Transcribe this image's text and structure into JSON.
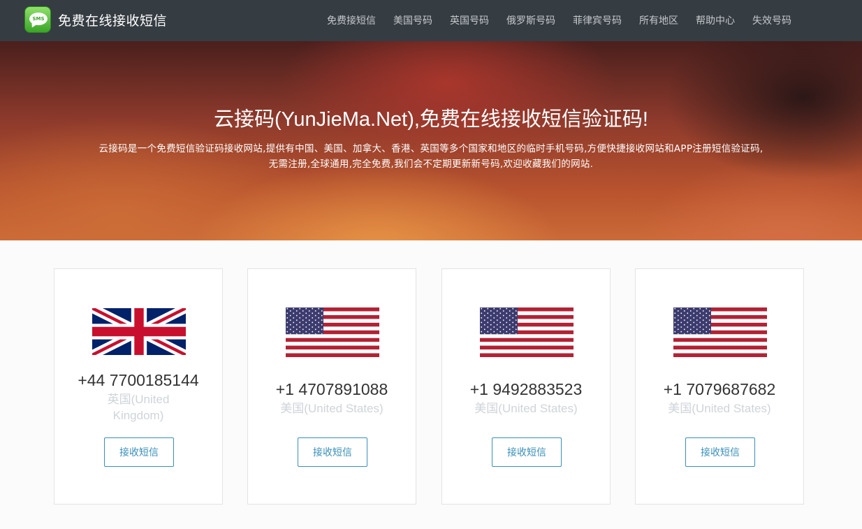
{
  "navbar": {
    "brand_icon_text": "SMS",
    "brand_title": "免费在线接收短信",
    "items": [
      {
        "label": "免费接短信"
      },
      {
        "label": "美国号码"
      },
      {
        "label": "英国号码"
      },
      {
        "label": "俄罗斯号码"
      },
      {
        "label": "菲律宾号码"
      },
      {
        "label": "所有地区"
      },
      {
        "label": "帮助中心"
      },
      {
        "label": "失效号码"
      }
    ]
  },
  "hero": {
    "title": "云接码(YunJieMa.Net),免费在线接收短信验证码!",
    "description_line1": "云接码是一个免费短信验证码接收网站,提供有中国、美国、加拿大、香港、英国等多个国家和地区的临时手机号码,方便快捷接收网站和APP注册短信验证码,",
    "description_line2": "无需注册,全球通用,完全免费,我们会不定期更新新号码,欢迎收藏我们的网站."
  },
  "cards": [
    {
      "flag": "uk-flag-icon",
      "phone": "+44 7700185144",
      "country": "英国(United Kingdom)",
      "button": "接收短信"
    },
    {
      "flag": "us-flag-icon",
      "phone": "+1 4707891088",
      "country": "美国(United States)",
      "button": "接收短信"
    },
    {
      "flag": "us-flag-icon",
      "phone": "+1 9492883523",
      "country": "美国(United States)",
      "button": "接收短信"
    },
    {
      "flag": "us-flag-icon",
      "phone": "+1 7079687682",
      "country": "美国(United States)",
      "button": "接收短信"
    }
  ],
  "colors": {
    "navbar_bg": "#353c42",
    "nav_text": "#c4c8cc",
    "button_accent": "#3a8fb7",
    "country_text": "#cfd4d9"
  }
}
